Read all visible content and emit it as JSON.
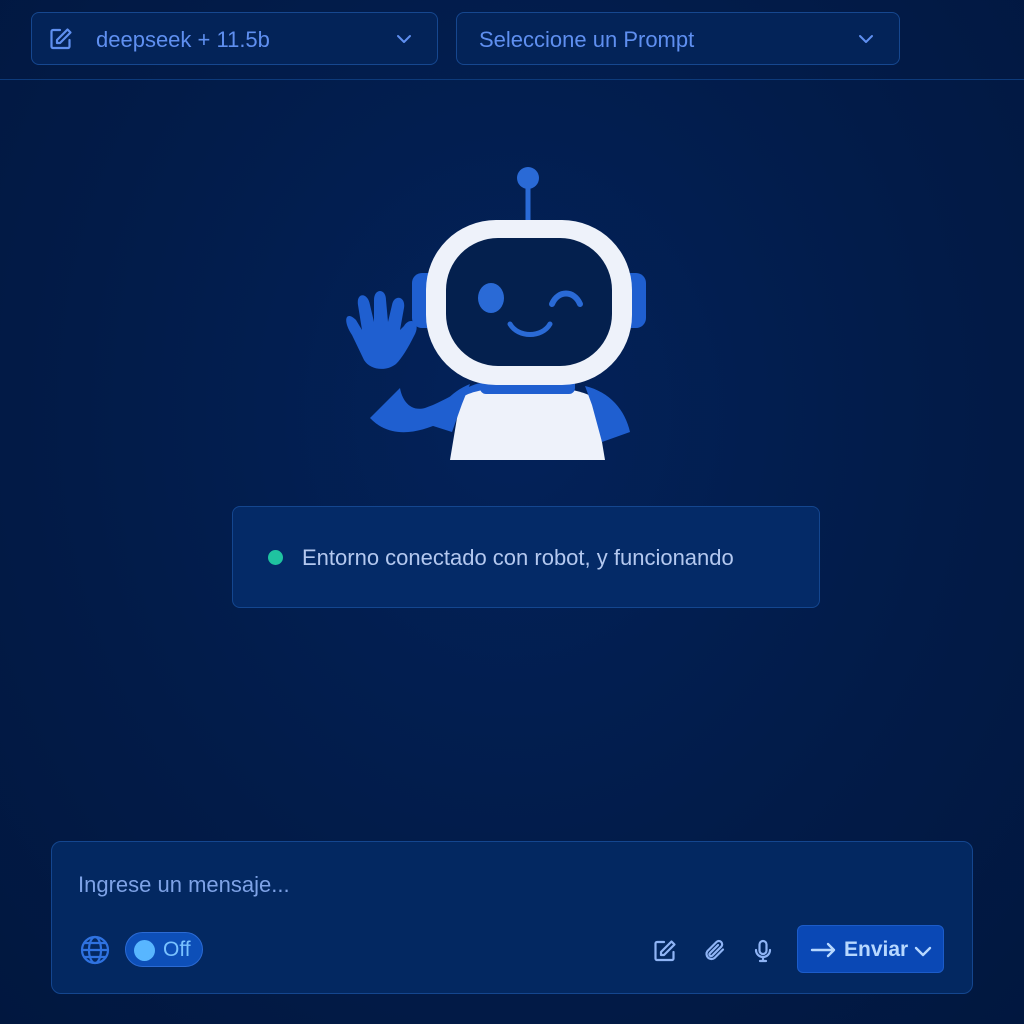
{
  "toolbar": {
    "model_select": {
      "value": "deepseek + 11.5b",
      "icon": "edit-icon"
    },
    "prompt_select": {
      "value": "Seleccione un Prompt"
    }
  },
  "hero": {
    "illustration": "waving-robot"
  },
  "status": {
    "text": "Entorno conectado con robot, y funcionando",
    "color": "#1fc3a0"
  },
  "composer": {
    "placeholder": "Ingrese un mensaje...",
    "web_search_icon": "globe-icon",
    "toggle_label": "Off",
    "tools": [
      "edit-icon",
      "paperclip-icon",
      "microphone-icon"
    ],
    "send_label": "Enviar"
  },
  "colors": {
    "background": "#021b48",
    "accent": "#0a48b5",
    "text_accent": "#5f8ff0"
  }
}
